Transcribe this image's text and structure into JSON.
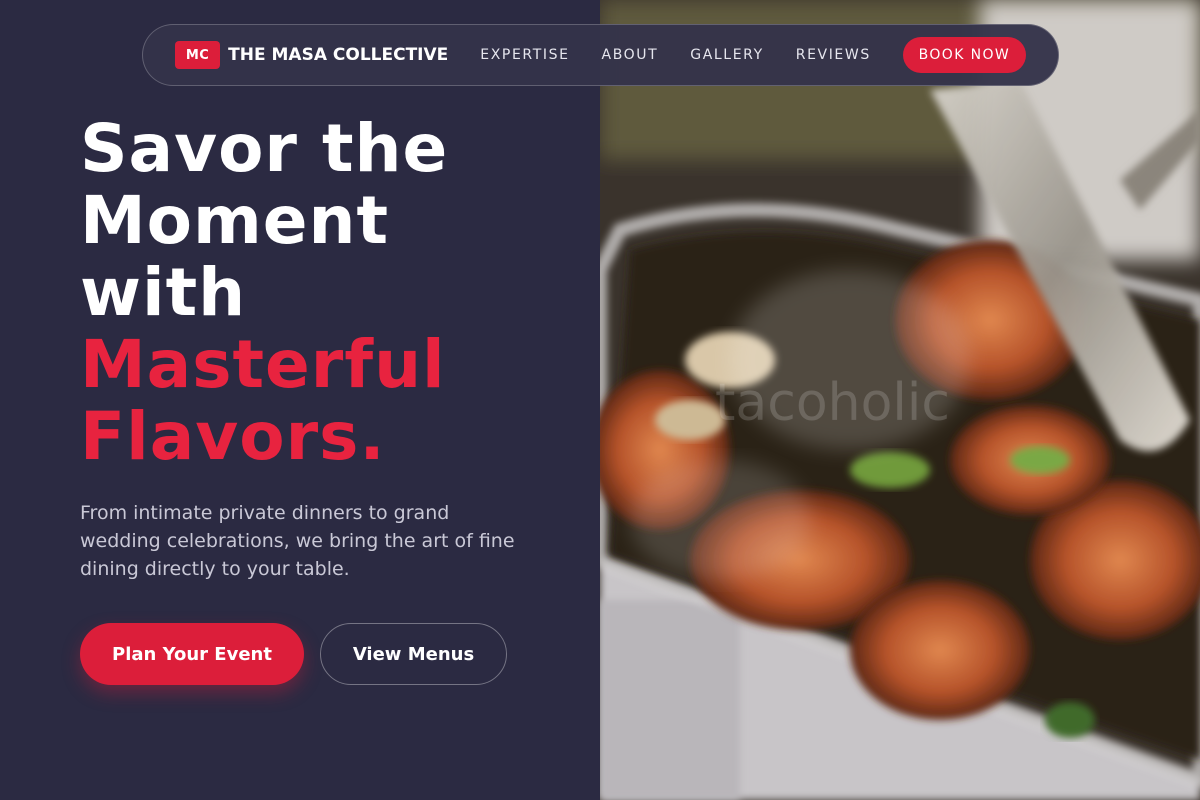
{
  "nav": {
    "logo_badge": "MC",
    "brand_name": "THE MASA COLLECTIVE",
    "links": [
      {
        "label": "EXPERTISE"
      },
      {
        "label": "ABOUT"
      },
      {
        "label": "GALLERY"
      },
      {
        "label": "REVIEWS"
      }
    ],
    "cta_label": "BOOK NOW"
  },
  "hero": {
    "headline_white": [
      "Savor the",
      "Moment",
      "with"
    ],
    "headline_red": [
      "Masterful",
      "Flavors."
    ],
    "subtext": "From intimate private dinners to grand wedding celebrations, we bring the art of fine dining directly to your table.",
    "primary_cta": "Plan Your Event",
    "secondary_cta": "View Menus",
    "photo_watermark": "tacoholic"
  },
  "colors": {
    "panel_bg": "#2b2a42",
    "accent": "#dc1e3a",
    "headline_accent": "#e8233f"
  }
}
